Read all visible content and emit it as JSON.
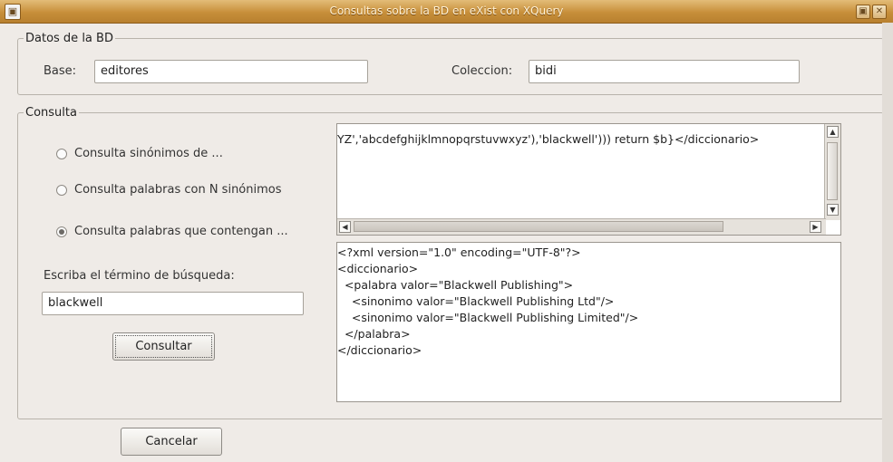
{
  "window": {
    "title": "Consultas sobre la BD  en eXist con XQuery",
    "app_icon": "app-icon",
    "maximize_icon": "▣",
    "close_icon": "✕"
  },
  "datos": {
    "legend": "Datos de la BD",
    "base_label": "Base:",
    "base_value": "editores",
    "coleccion_label": "Coleccion:",
    "coleccion_value": "bidi"
  },
  "consulta": {
    "legend": "Consulta",
    "options": [
      {
        "label": "Consulta sinónimos de ...",
        "selected": false
      },
      {
        "label": "Consulta palabras con N sinónimos",
        "selected": false
      },
      {
        "label": "Consulta palabras que contengan ...",
        "selected": true
      }
    ],
    "search_label": "Escriba el término de búsqueda:",
    "search_value": "blackwell",
    "submit_label": "Consultar",
    "query_text": "YZ','abcdefghijklmnopqrstuvwxyz'),'blackwell'))) return $b}</diccionario>",
    "result_lines": [
      "<?xml version=\"1.0\" encoding=\"UTF-8\"?>",
      "<diccionario>",
      "  <palabra valor=\"Blackwell Publishing\">",
      "    <sinonimo valor=\"Blackwell Publishing Ltd\"/>",
      "    <sinonimo valor=\"Blackwell Publishing Limited\"/>",
      "  </palabra>",
      "</diccionario>"
    ]
  },
  "footer": {
    "cancel_label": "Cancelar"
  }
}
